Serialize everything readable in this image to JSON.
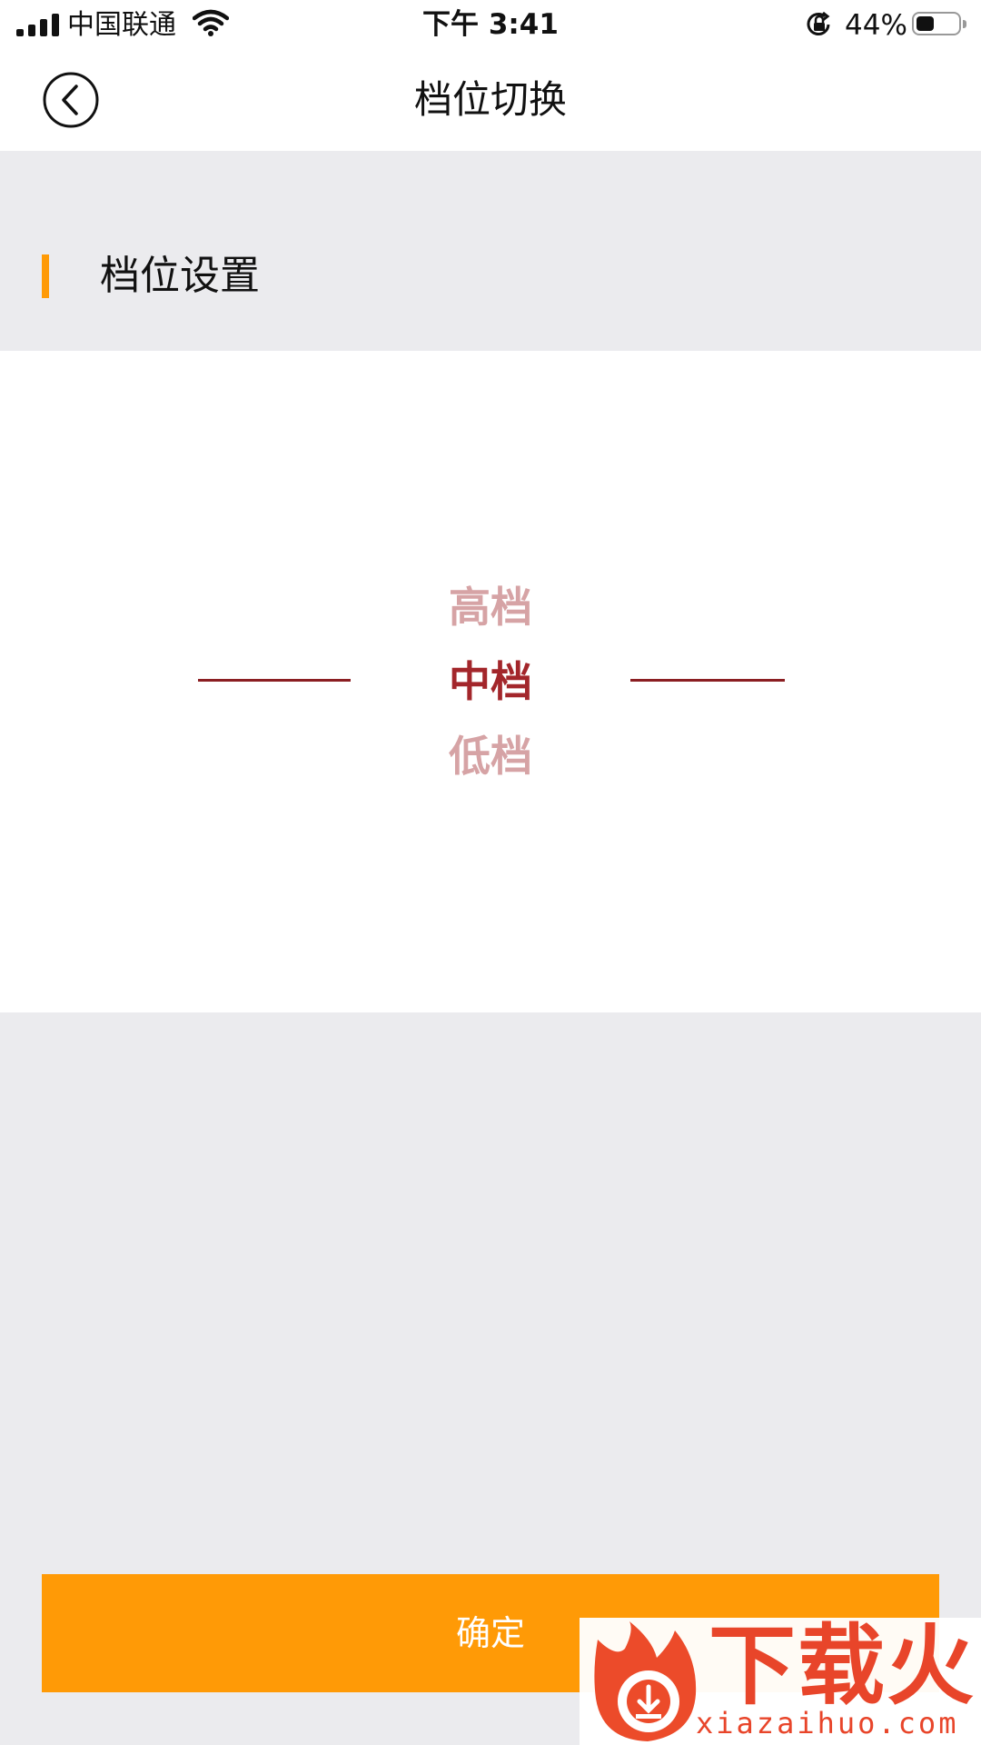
{
  "status_bar": {
    "carrier": "中国联通",
    "time": "下午 3:41",
    "battery_text": "44%",
    "battery_level": 0.44,
    "icons": [
      "signal-icon",
      "wifi-icon",
      "orientation-lock-icon",
      "battery-icon"
    ]
  },
  "nav": {
    "title": "档位切换",
    "back_icon": "back-chevron-icon"
  },
  "section": {
    "title": "档位设置",
    "accent_color": "#ff9a06"
  },
  "picker": {
    "options": [
      "高档",
      "中档",
      "低档"
    ],
    "selected": "中档",
    "selected_color": "#a3262b",
    "unselected_color": "#d6a3a5"
  },
  "confirm": {
    "label": "确定",
    "color": "#ff9a06"
  },
  "watermark": {
    "brand": "下载火",
    "url": "xiazaihuo.com"
  }
}
